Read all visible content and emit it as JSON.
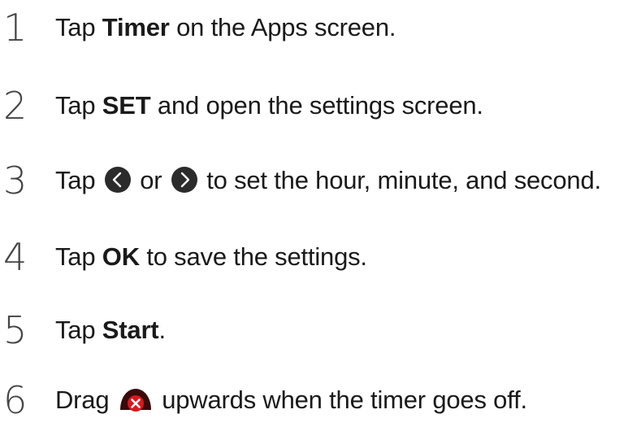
{
  "steps": [
    {
      "number": "1",
      "before": "Tap ",
      "bold": "Timer",
      "after": " on the Apps screen."
    },
    {
      "number": "2",
      "before": "Tap ",
      "bold": "SET",
      "after": " and open the settings screen."
    },
    {
      "number": "3",
      "before": "Tap ",
      "middle": " or ",
      "after": " to set the hour, minute, and second.",
      "icon_left": "chevron-left-circle-icon",
      "icon_right": "chevron-right-circle-icon"
    },
    {
      "number": "4",
      "before": "Tap ",
      "bold": "OK",
      "after": " to save the settings."
    },
    {
      "number": "5",
      "before": "Tap ",
      "bold": "Start",
      "after": "."
    },
    {
      "number": "6",
      "before": "Drag ",
      "after": " upwards when the timer goes off.",
      "icon": "dismiss-alarm-icon"
    }
  ],
  "colors": {
    "text": "#1a1a1a",
    "number": "#444444",
    "chevron_circle": "#2b2b2b",
    "dismiss_red": "#d7191c",
    "dismiss_dark": "#3a0a0a"
  }
}
